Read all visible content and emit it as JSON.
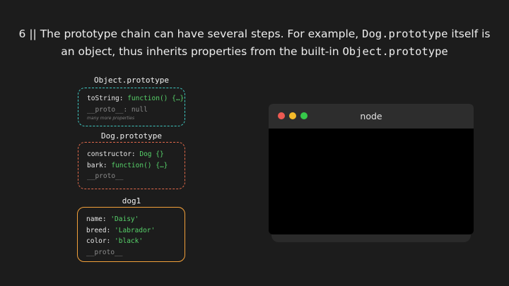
{
  "title": {
    "line1_prefix": "6 || The prototype chain can have several steps. For example, ",
    "line1_code": "Dog.prototype",
    "line1_suffix": " itself is",
    "line2_prefix": "an object, thus inherits properties from the built-in ",
    "line2_code": "Object.prototype"
  },
  "boxes": {
    "object_prototype": {
      "label": "Object.prototype",
      "tostring_key": "toString: ",
      "tostring_val": "function() {…}",
      "proto_line": "__proto__: null",
      "note": "many more properties"
    },
    "dog_prototype": {
      "label": "Dog.prototype",
      "constructor_key": "constructor: ",
      "constructor_val": "Dog {}",
      "bark_key": "bark: ",
      "bark_val": "function() {…}",
      "proto_line": "__proto__"
    },
    "dog1": {
      "label": "dog1",
      "name_key": "name: ",
      "name_val": "'Daisy'",
      "breed_key": "breed: ",
      "breed_val": "'Labrador'",
      "color_key": "color: ",
      "color_val": "'black'",
      "proto_line": "__proto__"
    }
  },
  "terminal": {
    "title": "node",
    "buttons": [
      "close",
      "minimize",
      "maximize"
    ]
  },
  "colors": {
    "background": "#1c1c1c",
    "object_border": "#3fc7c0",
    "dogproto_border": "#e0694a",
    "dog1_border": "#f2a03a",
    "value_green": "#57d26a"
  }
}
